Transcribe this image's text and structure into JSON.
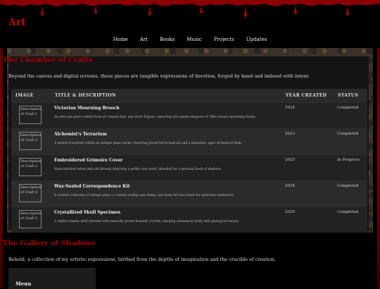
{
  "site": {
    "title": "Art"
  },
  "nav": {
    "items": [
      "Home",
      "Art",
      "Books",
      "Music",
      "Projects",
      "Updates"
    ]
  },
  "crafts": {
    "title": "The Chamber of Crafts",
    "description": "Beyond the canvas and digital screens, these pieces are tangible expressions of devotion, forged by hand and imbued with intent.",
    "headers": {
      "image": "IMAGE",
      "title": "TITLE & DESCRIPTION",
      "year": "YEAR CREATED",
      "status": "STATUS"
    },
    "rows": [
      {
        "alt": "Description of Craft 1",
        "title": "Victorian Mourning Brooch",
        "desc": "An intricate piece crafted from jet, human hair, and silver filigree, capturing the solemn elegance of 19th-century mourning rituals.",
        "year": "2024",
        "status": "Completed"
      },
      {
        "alt": "Description of Craft 2",
        "title": "Alchemist's Terrarium",
        "desc": "A sealed ecosystem within an antique glass cloche, featuring preserved botanicals and a miniature, aged alchemical flask.",
        "year": "2023",
        "status": "Completed"
      },
      {
        "alt": "Description of Craft 3",
        "title": "Embroidered Grimoire Cover",
        "desc": "Hand-stitched velvet and silk threads depicting a gothic rose motif, intended for a personal book of shadows.",
        "year": "2025",
        "status": "In Progress"
      },
      {
        "alt": "Description of Craft 4",
        "title": "Wax-Sealed Correspondence Kit",
        "desc": "A curated collection of vintage paper, a custom sealing wax stamp, and deep red wax beads for epistolary endeavors.",
        "year": "2024",
        "status": "Completed"
      },
      {
        "alt": "Description of Craft 5",
        "title": "Crystallized Skull Specimen",
        "desc": "A replica human skull adorned with naturally grown bismuth crystals, merging anatomical study with geological beauty.",
        "year": "2025",
        "status": "Completed"
      }
    ]
  },
  "gallery": {
    "title": "The Gallery of Shadows",
    "description": "Behold, a collection of my artistic expressions, birthed from the depths of imagination and the crucible of creation."
  },
  "menu": {
    "label": "Menu"
  },
  "colors": {
    "accent": "#a00000",
    "background": "#000000",
    "drip": "#b00000"
  }
}
